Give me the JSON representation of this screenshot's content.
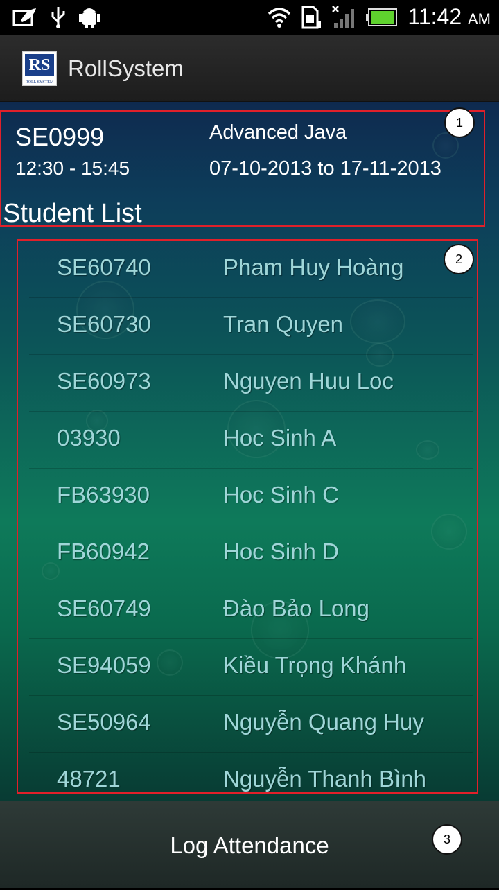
{
  "status_bar": {
    "time": "11:42",
    "ampm": "AM",
    "icons": [
      "app-notification-icon",
      "usb-icon",
      "android-debug-icon",
      "wifi-icon",
      "sim-icon",
      "no-signal-icon",
      "battery-icon"
    ]
  },
  "app": {
    "logo_text": "RS",
    "logo_subtext": "ROLL SYSTEM",
    "title": "RollSystem"
  },
  "course": {
    "code": "SE0999",
    "time": "12:30 - 15:45",
    "name": "Advanced Java",
    "dates": "07-10-2013 to 17-11-2013"
  },
  "list_title": "Student List",
  "students": [
    {
      "id": "SE60740",
      "name": "Pham Huy Hoàng"
    },
    {
      "id": "SE60730",
      "name": "Tran Quyen"
    },
    {
      "id": "SE60973",
      "name": "Nguyen Huu Loc"
    },
    {
      "id": "03930",
      "name": "Hoc Sinh A"
    },
    {
      "id": "FB63930",
      "name": "Hoc Sinh C"
    },
    {
      "id": "FB60942",
      "name": "Hoc Sinh D"
    },
    {
      "id": "SE60749",
      "name": "Đào Bảo Long"
    },
    {
      "id": "SE94059",
      "name": "Kiều Trọng Khánh"
    },
    {
      "id": "SE50964",
      "name": "Nguyễn Quang Huy"
    },
    {
      "id": "48721",
      "name": "Nguyễn Thanh Bình"
    }
  ],
  "button": {
    "log_attendance": "Log Attendance"
  },
  "markers": [
    "1",
    "2",
    "3"
  ],
  "colors": {
    "highlight_border": "#e0202a",
    "student_text": "#9fd6d8",
    "logo_blue": "#1a3f8a"
  }
}
